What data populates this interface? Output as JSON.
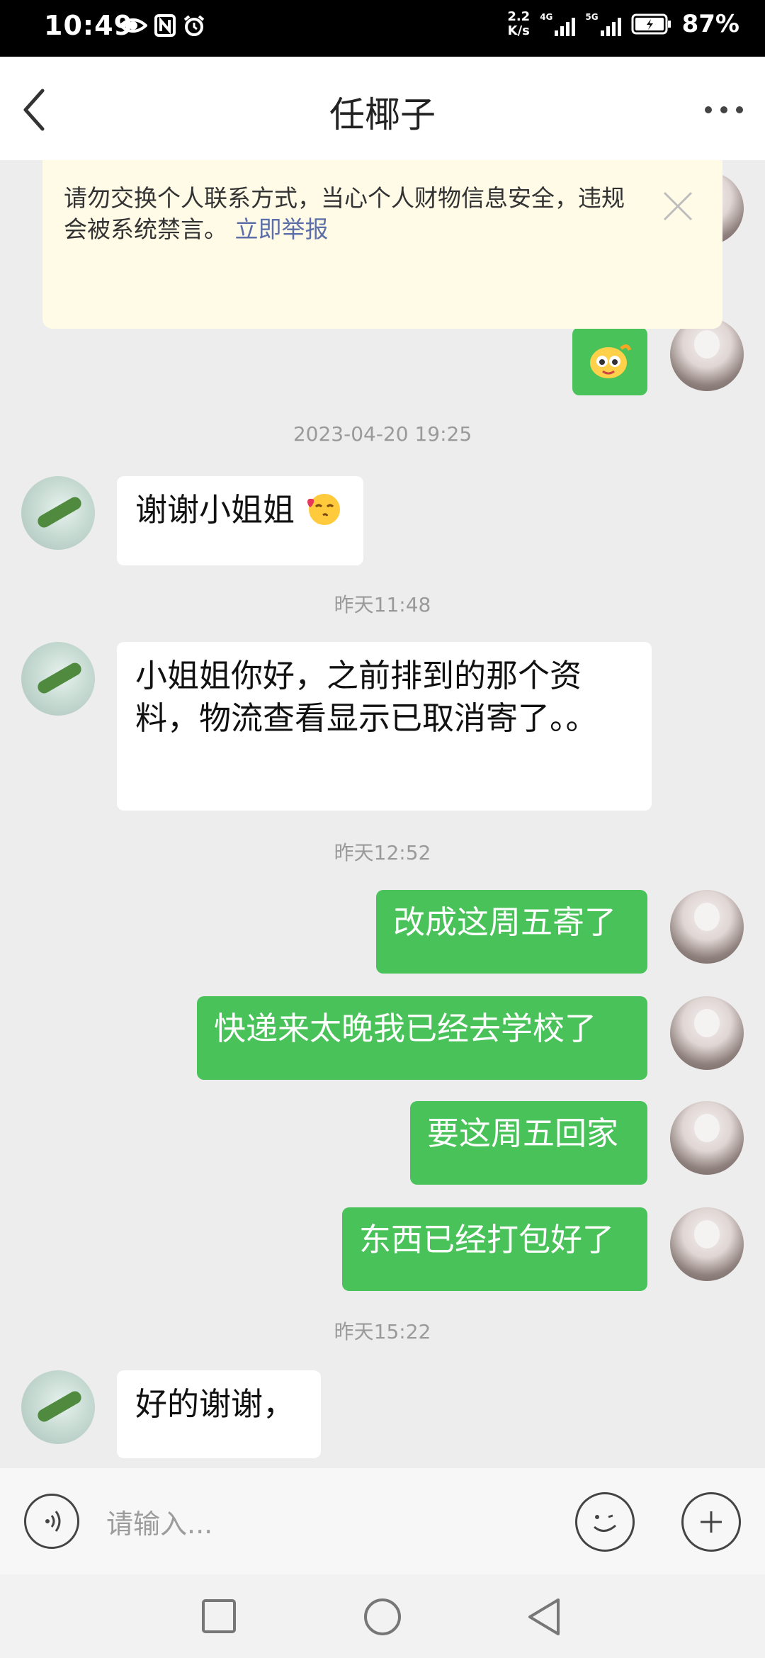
{
  "status_bar": {
    "time": "10:49",
    "speed_value": "2.2",
    "speed_unit": "K/s",
    "sig1": "4G",
    "sig2": "5G",
    "battery": "87%"
  },
  "nav": {
    "title": "任椰子"
  },
  "notice": {
    "text": "请勿交换个人联系方式，当心个人财物信息安全，违规会被系统禁言。",
    "link": "立即举报"
  },
  "timestamps": [
    "2023-04-20 19:25",
    "昨天11:48",
    "昨天12:52",
    "昨天15:22"
  ],
  "messages": [
    {
      "from": "them",
      "text": "谢谢小姐姐"
    },
    {
      "from": "them",
      "text": "小姐姐你好，之前排到的那个资料，物流查看显示已取消寄了。。"
    },
    {
      "from": "me",
      "text": "改成这周五寄了"
    },
    {
      "from": "me",
      "text": "快递来太晚我已经去学校了"
    },
    {
      "from": "me",
      "text": "要这周五回家"
    },
    {
      "from": "me",
      "text": "东西已经打包好了"
    },
    {
      "from": "them",
      "text": "好的谢谢，"
    }
  ],
  "input": {
    "placeholder": "请输入..."
  },
  "icons": [
    "eye-icon",
    "nfc-icon",
    "alarm-icon",
    "back-icon",
    "more-icon",
    "close-icon",
    "voice-icon",
    "emoji-icon",
    "plus-icon",
    "recents-icon",
    "home-icon",
    "back-nav-icon"
  ],
  "colors": {
    "bubble_me": "#49c25a",
    "notice_bg": "#fffbe7",
    "link": "#5d6fa8"
  }
}
